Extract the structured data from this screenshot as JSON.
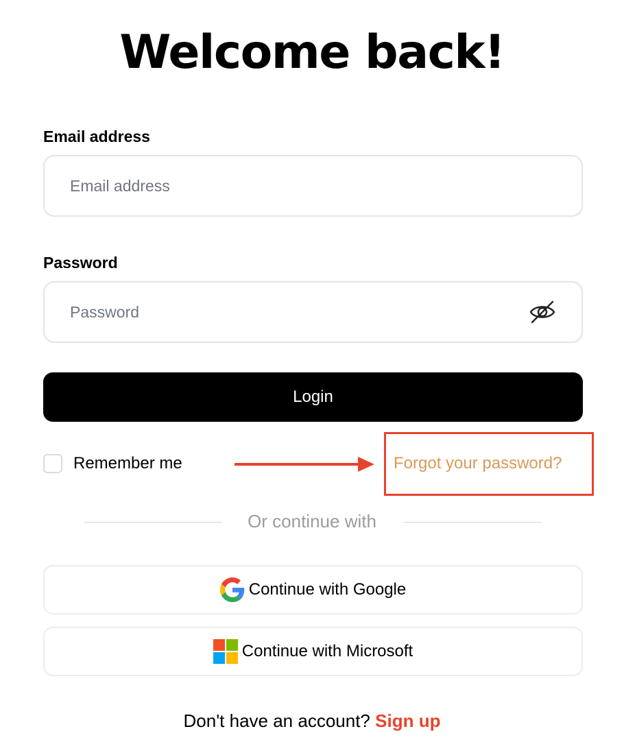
{
  "header": {
    "title": "Welcome back!"
  },
  "form": {
    "email": {
      "label": "Email address",
      "placeholder": "Email address",
      "value": ""
    },
    "password": {
      "label": "Password",
      "placeholder": "Password",
      "value": "",
      "toggle_icon": "eye-off-icon"
    },
    "login_label": "Login",
    "remember": {
      "label": "Remember me",
      "checked": false
    },
    "forgot_label": "Forgot your password?"
  },
  "divider": {
    "label": "Or continue with"
  },
  "social": {
    "google_label": "Continue with Google",
    "google_icon": "google-logo-icon",
    "microsoft_label": "Continue with Microsoft",
    "microsoft_icon": "microsoft-logo-icon"
  },
  "footer": {
    "prompt": "Don't have an account?",
    "signup_label": "Sign up"
  },
  "colors": {
    "accent": "#e8442c",
    "forgot_link": "#d99a57",
    "primary_button": "#000000",
    "input_border": "#e2e4e8",
    "placeholder": "#6f7681"
  }
}
